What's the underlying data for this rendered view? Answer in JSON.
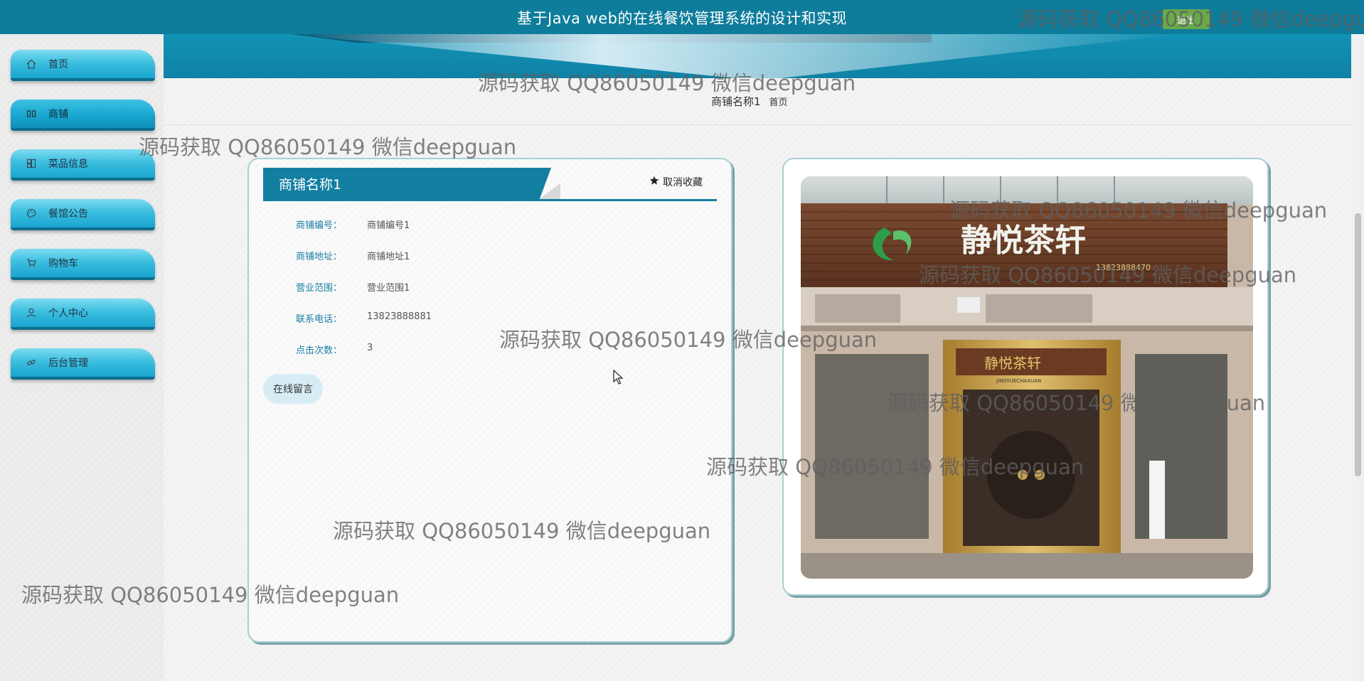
{
  "header": {
    "title": "基于Java web的在线餐饮管理系统的设计和实现",
    "logout_label": "退出"
  },
  "sidebar": {
    "items": [
      {
        "label": "首页",
        "icon": "home-icon"
      },
      {
        "label": "商铺",
        "icon": "store-icon",
        "active": true
      },
      {
        "label": "菜品信息",
        "icon": "grid-icon"
      },
      {
        "label": "餐馆公告",
        "icon": "palette-icon"
      },
      {
        "label": "购物车",
        "icon": "cart-icon"
      },
      {
        "label": "个人中心",
        "icon": "user-icon"
      },
      {
        "label": "后台管理",
        "icon": "link-icon"
      }
    ]
  },
  "breadcrumb": {
    "current": "商铺名称1",
    "home": "首页"
  },
  "detail": {
    "name": "商铺名称1",
    "favorite_label": "取消收藏",
    "fields": [
      {
        "label": "商铺编号：",
        "value": "商铺编号1"
      },
      {
        "label": "商铺地址：",
        "value": "商铺地址1"
      },
      {
        "label": "营业范围：",
        "value": "营业范围1"
      },
      {
        "label": "联系电话：",
        "value": "13823888881"
      },
      {
        "label": "点击次数：",
        "value": "3"
      }
    ],
    "message_button": "在线留言"
  },
  "photo": {
    "sign_text": "静悦茶轩",
    "sub_sign": "JINGYUECHAXUAN",
    "phone_on_sign": "13823888470"
  },
  "watermark": "源码获取 QQ86050149 微信deepguan",
  "colors": {
    "primary": "#137fa0",
    "header": "#0e7c9b",
    "logout": "#6aa94a"
  }
}
